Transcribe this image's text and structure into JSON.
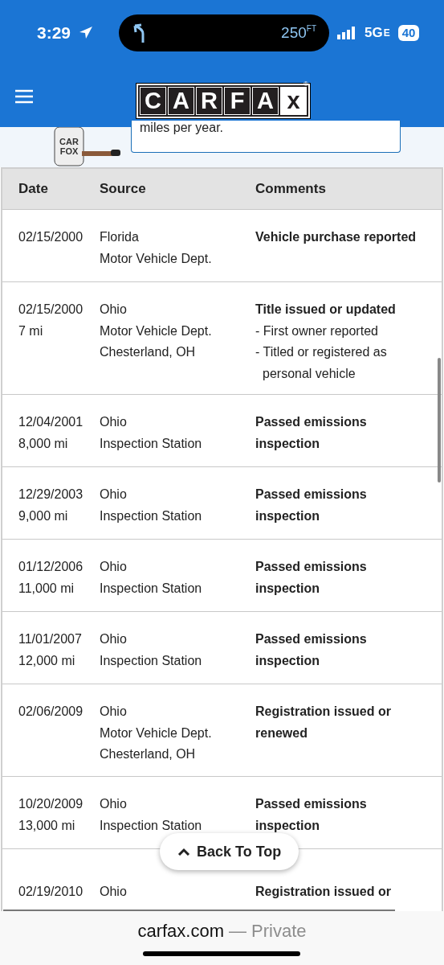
{
  "status_bar": {
    "time": "3:29",
    "navigation_distance": "250",
    "navigation_unit": "FT",
    "network": "5G",
    "network_suffix": "E",
    "battery": "40"
  },
  "header": {
    "logo_letters": [
      {
        "letter": "C",
        "kind": "dark"
      },
      {
        "letter": "A",
        "kind": "dark"
      },
      {
        "letter": "R",
        "kind": "dark"
      },
      {
        "letter": "F",
        "kind": "dark"
      },
      {
        "letter": "A",
        "kind": "dark"
      },
      {
        "letter": "x",
        "kind": "light"
      }
    ],
    "logo_mark": "®"
  },
  "tip_card": {
    "text": "miles per year.",
    "mascot_shirt": [
      "CAR",
      "FOX"
    ]
  },
  "table": {
    "columns": [
      "Date",
      "Source",
      "Comments"
    ],
    "rows": [
      {
        "date": [
          "02/15/2000"
        ],
        "source": [
          "Florida",
          "Motor Vehicle Dept."
        ],
        "comment_title": "Vehicle purchase reported",
        "comment_items": []
      },
      {
        "date": [
          "02/15/2000",
          "7 mi"
        ],
        "source": [
          "Ohio",
          "Motor Vehicle Dept.",
          "Chesterland, OH"
        ],
        "comment_title": "Title issued or updated",
        "comment_items": [
          "- First owner reported",
          "- Titled or registered as personal vehicle"
        ]
      },
      {
        "date": [
          "12/04/2001",
          "8,000 mi"
        ],
        "source": [
          "Ohio",
          "Inspection Station"
        ],
        "comment_title": "Passed emissions inspection",
        "comment_items": []
      },
      {
        "date": [
          "12/29/2003",
          "9,000 mi"
        ],
        "source": [
          "Ohio",
          "Inspection Station"
        ],
        "comment_title": "Passed emissions inspection",
        "comment_items": []
      },
      {
        "date": [
          "01/12/2006",
          "11,000 mi"
        ],
        "source": [
          "Ohio",
          "Inspection Station"
        ],
        "comment_title": "Passed emissions inspection",
        "comment_items": []
      },
      {
        "date": [
          "11/01/2007",
          "12,000 mi"
        ],
        "source": [
          "Ohio",
          "Inspection Station"
        ],
        "comment_title": "Passed emissions inspection",
        "comment_items": []
      },
      {
        "date": [
          "02/06/2009"
        ],
        "source": [
          "Ohio",
          "Motor Vehicle Dept.",
          "Chesterland, OH"
        ],
        "comment_title": "Registration issued or renewed",
        "comment_items": []
      },
      {
        "date": [
          "10/20/2009",
          "13,000 mi"
        ],
        "source": [
          "Ohio",
          "Inspection Station"
        ],
        "comment_title": "Passed emissions inspection",
        "comment_items": []
      },
      {
        "date": [
          "02/19/2010"
        ],
        "source": [
          "Ohio"
        ],
        "comment_title": "Registration issued or",
        "comment_items": []
      }
    ]
  },
  "back_to_top": "Back To Top",
  "browser_bar": {
    "domain": "carfax.com",
    "mode": "— Private"
  }
}
